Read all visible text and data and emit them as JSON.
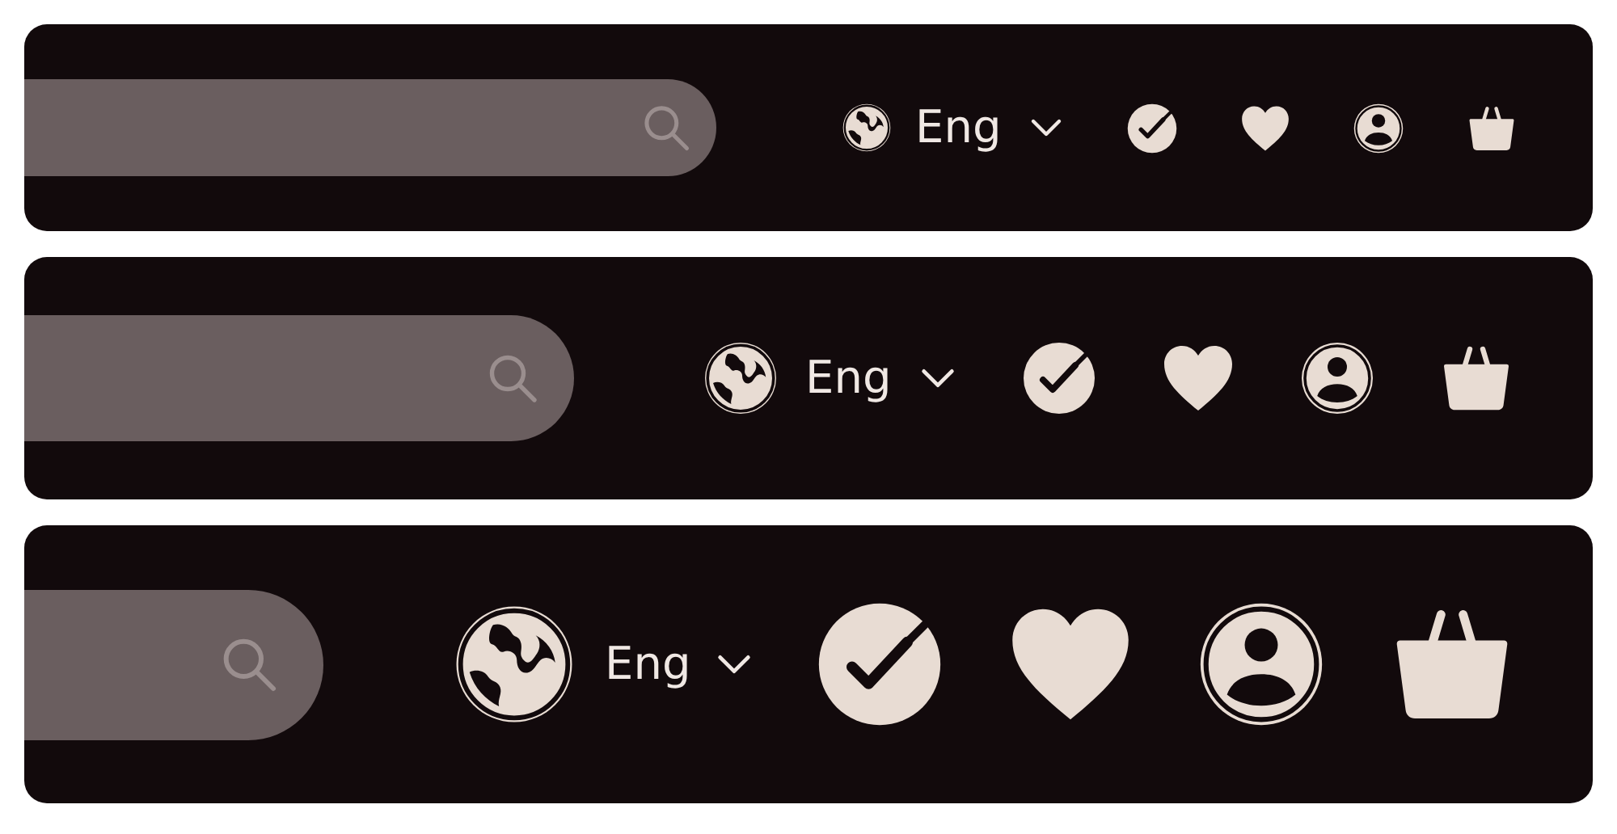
{
  "headers": [
    {
      "language": "Eng"
    },
    {
      "language": "Eng"
    },
    {
      "language": "Eng"
    }
  ]
}
